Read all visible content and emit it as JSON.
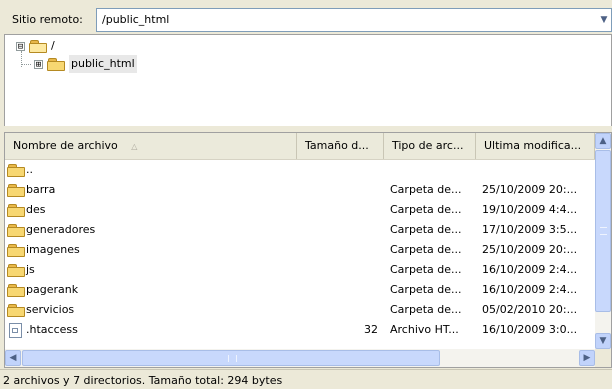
{
  "remote": {
    "label": "Sitio remoto:",
    "path": "/public_html",
    "dropdown_icon": "chevron-down-icon"
  },
  "tree": {
    "root": {
      "label": "/",
      "expander": "⊟"
    },
    "child": {
      "label": "public_html",
      "expander": "⊞"
    }
  },
  "list": {
    "columns": {
      "name": "Nombre de archivo",
      "size": "Tamaño d...",
      "type": "Tipo de arc...",
      "modified": "Ultima modifica..."
    },
    "sort_arrow": "△",
    "rows": [
      {
        "name": "..",
        "size": "",
        "type": "",
        "modified": "",
        "icon": "folder-icon"
      },
      {
        "name": "barra",
        "size": "",
        "type": "Carpeta de...",
        "modified": "25/10/2009 20:...",
        "icon": "folder-icon"
      },
      {
        "name": "des",
        "size": "",
        "type": "Carpeta de...",
        "modified": "19/10/2009 4:4...",
        "icon": "folder-icon"
      },
      {
        "name": "generadores",
        "size": "",
        "type": "Carpeta de...",
        "modified": "17/10/2009 3:5...",
        "icon": "folder-icon"
      },
      {
        "name": "imagenes",
        "size": "",
        "type": "Carpeta de...",
        "modified": "25/10/2009 20:...",
        "icon": "folder-icon"
      },
      {
        "name": "js",
        "size": "",
        "type": "Carpeta de...",
        "modified": "16/10/2009 2:4...",
        "icon": "folder-icon"
      },
      {
        "name": "pagerank",
        "size": "",
        "type": "Carpeta de...",
        "modified": "16/10/2009 2:4...",
        "icon": "folder-icon"
      },
      {
        "name": "servicios",
        "size": "",
        "type": "Carpeta de...",
        "modified": "05/02/2010 20:...",
        "icon": "folder-icon"
      },
      {
        "name": ".htaccess",
        "size": "32",
        "type": "Archivo HT...",
        "modified": "16/10/2009 3:0...",
        "icon": "file-icon"
      }
    ]
  },
  "scrollbars": {
    "up": "▲",
    "down": "▼",
    "left": "◀",
    "right": "▶"
  },
  "status": {
    "text": "2 archivos y 7 directorios. Tamaño total: 294 bytes"
  },
  "colors": {
    "window_bg": "#ece9d8",
    "folder": "#f7d772",
    "scrollbar": "#c8d8fc"
  }
}
